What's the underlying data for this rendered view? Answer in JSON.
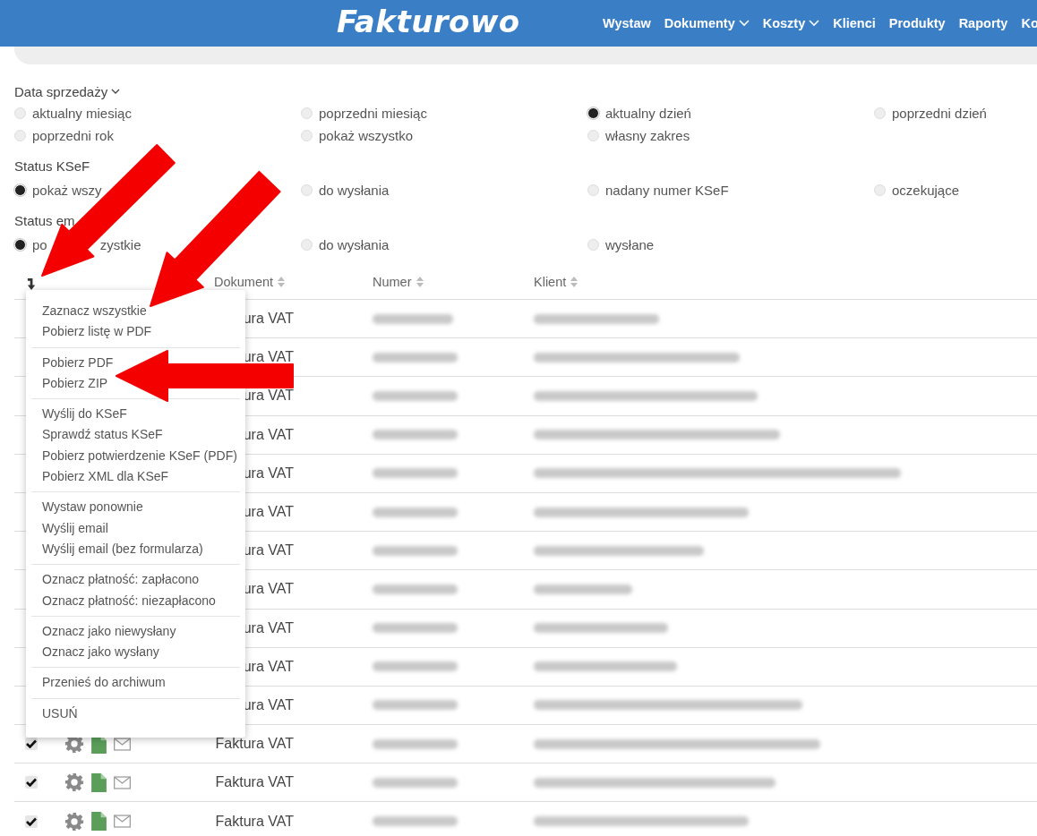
{
  "header": {
    "logo": "Fakturowo",
    "nav": [
      {
        "label": "Wystaw",
        "dropdown": false
      },
      {
        "label": "Dokumenty",
        "dropdown": true
      },
      {
        "label": "Koszty",
        "dropdown": true
      },
      {
        "label": "Klienci",
        "dropdown": false
      },
      {
        "label": "Produkty",
        "dropdown": false
      },
      {
        "label": "Raporty",
        "dropdown": false
      },
      {
        "label": "Ko",
        "dropdown": false
      }
    ]
  },
  "filters": [
    {
      "title": "Data sprzedaży",
      "dropdown": true,
      "options": [
        {
          "label": "aktualny miesiąc",
          "selected": false
        },
        {
          "label": "poprzedni miesiąc",
          "selected": false
        },
        {
          "label": "aktualny dzień",
          "selected": true
        },
        {
          "label": "poprzedni dzień",
          "selected": false
        },
        {
          "label": "poprzedni rok",
          "selected": false
        },
        {
          "label": "pokaż wszystko",
          "selected": false
        },
        {
          "label": "własny zakres",
          "selected": false
        }
      ]
    },
    {
      "title": "Status KSeF",
      "dropdown": false,
      "options": [
        {
          "label": "pokaż wszy",
          "selected": true
        },
        {
          "label": "do wysłania",
          "selected": false
        },
        {
          "label": "nadany numer KSeF",
          "selected": false
        },
        {
          "label": "oczekujące",
          "selected": false
        }
      ]
    },
    {
      "title": "Status em",
      "dropdown": false,
      "options": [
        {
          "label": "po",
          "label_rest": "zystkie",
          "selected": true
        },
        {
          "label": "do wysłania",
          "selected": false
        },
        {
          "label": "wysłane",
          "selected": false
        }
      ]
    }
  ],
  "table": {
    "columns": [
      {
        "label": "Dokument",
        "sortable": true
      },
      {
        "label": "Numer",
        "sortable": true
      },
      {
        "label": "Klient",
        "sortable": true
      }
    ],
    "rows": [
      {
        "document": "ura VAT"
      },
      {
        "document": "ura VAT"
      },
      {
        "document": "ura VAT"
      },
      {
        "document": "ura VAT"
      },
      {
        "document": "ura VAT"
      },
      {
        "document": "ura VAT"
      },
      {
        "document": "ura VAT"
      },
      {
        "document": "ura VAT"
      },
      {
        "document": "ura VAT"
      },
      {
        "document": "ura VAT"
      },
      {
        "document": "ura VAT"
      },
      {
        "checked": true,
        "document": "Faktura VAT"
      },
      {
        "checked": true,
        "document": "Faktura VAT"
      },
      {
        "checked": true,
        "document": "Faktura VAT"
      }
    ]
  },
  "menu": {
    "groups": [
      [
        "Zaznacz wszystkie",
        "Pobierz listę w PDF"
      ],
      [
        "Pobierz PDF",
        "Pobierz ZIP"
      ],
      [
        "Wyślij do KSeF",
        "Sprawdź status KSeF",
        "Pobierz potwierdzenie KSeF (PDF)",
        "Pobierz XML dla KSeF"
      ],
      [
        "Wystaw ponownie",
        "Wyślij email",
        "Wyślij email (bez formularza)"
      ],
      [
        "Oznacz płatność: zapłacono",
        "Oznacz płatność: niezapłacono"
      ],
      [
        "Oznacz jako niewysłany",
        "Oznacz jako wysłany"
      ],
      [
        "Przenieś do archiwum"
      ],
      [
        "USUŃ"
      ]
    ]
  }
}
